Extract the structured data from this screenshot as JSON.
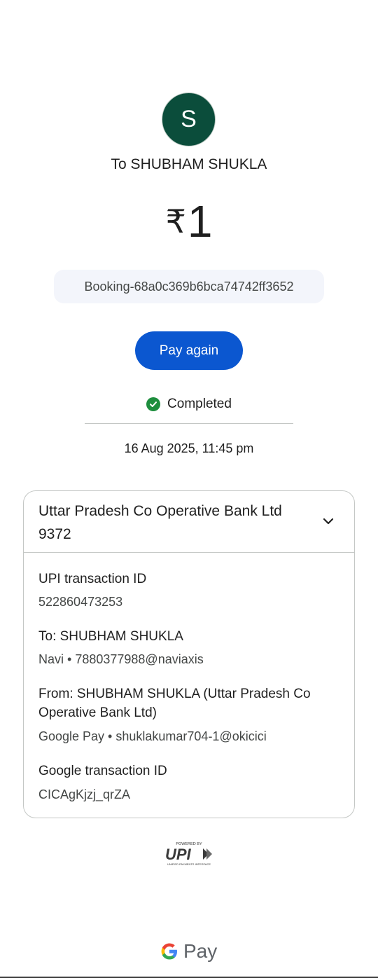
{
  "recipient": {
    "avatar_initial": "S",
    "title": "To SHUBHAM SHUKLA"
  },
  "amount": {
    "currency_symbol": "₹",
    "value": "1"
  },
  "note": "Booking-68a0c369b6bca74742ff3652",
  "actions": {
    "pay_again_label": "Pay again"
  },
  "status": {
    "label": "Completed",
    "icon": "check-circle-icon",
    "color": "#1e8e3e"
  },
  "datetime": "16 Aug 2025, 11:45 pm",
  "details_card": {
    "bank_name": "Uttar Pradesh Co Operative Bank Ltd",
    "account_suffix": "9372",
    "expand_icon": "chevron-down-icon",
    "upi_txn_label": "UPI transaction ID",
    "upi_txn_value": "522860473253",
    "to_label": "To: SHUBHAM SHUKLA",
    "to_value": "Navi • 7880377988@naviaxis",
    "from_label": "From: SHUBHAM SHUKLA (Uttar Pradesh Co Operative Bank Ltd)",
    "from_value": "Google Pay • shuklakumar704-1@okicici",
    "google_txn_label": "Google transaction ID",
    "google_txn_value": "CICAgKjzj_qrZA"
  },
  "footer": {
    "upi_powered_by": "POWERED BY",
    "upi_wordmark": "UPI",
    "upi_tagline": "UNIFIED PAYMENTS INTERFACE",
    "brand_letter": "G",
    "brand_text": "Pay"
  },
  "colors": {
    "primary_button": "#0b57d0",
    "avatar_bg": "#0b4d3b",
    "chip_bg": "#f3f5fb"
  }
}
